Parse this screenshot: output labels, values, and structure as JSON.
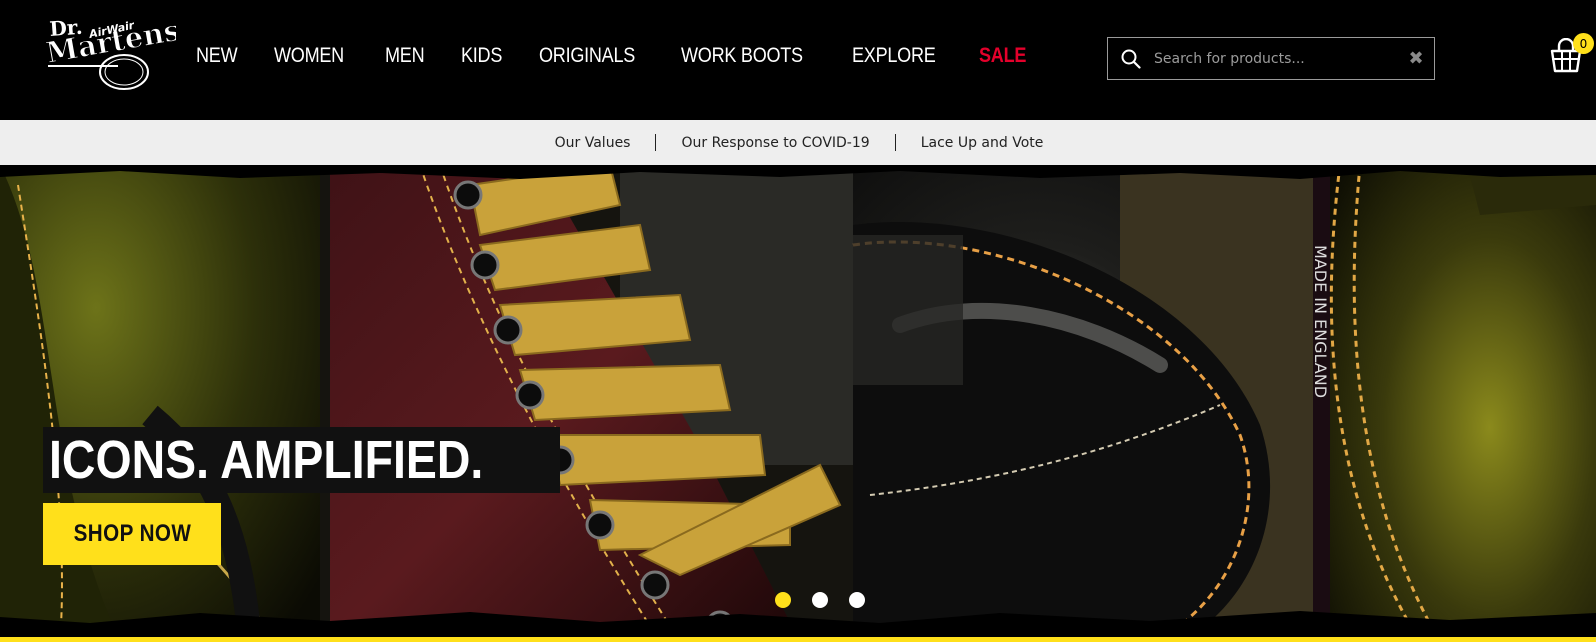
{
  "header": {
    "logo_text_top": "Dr.",
    "logo_text_main": "Martens",
    "logo_text_air": "AirWair",
    "nav": [
      "NEW",
      "WOMEN",
      "MEN",
      "KIDS",
      "ORIGINALS",
      "WORK BOOTS",
      "EXPLORE",
      "SALE"
    ],
    "search": {
      "placeholder": "Search for products...",
      "icon": "search-icon",
      "clear_icon": "close-icon"
    },
    "cart": {
      "icon": "basket-icon",
      "count": "0"
    }
  },
  "utility_bar": {
    "links": [
      "Our Values",
      "Our Response to COVID-19",
      "Lace Up and Vote"
    ]
  },
  "hero": {
    "headline": "ICONS. AMPLIFIED.",
    "cta": "SHOP NOW",
    "carousel_dots": 3,
    "active_dot": 0
  },
  "colors": {
    "accent_yellow": "#ffe01b",
    "sale_red": "#e4002b",
    "header_bg": "#000000",
    "utility_bg": "#eeeeee"
  }
}
